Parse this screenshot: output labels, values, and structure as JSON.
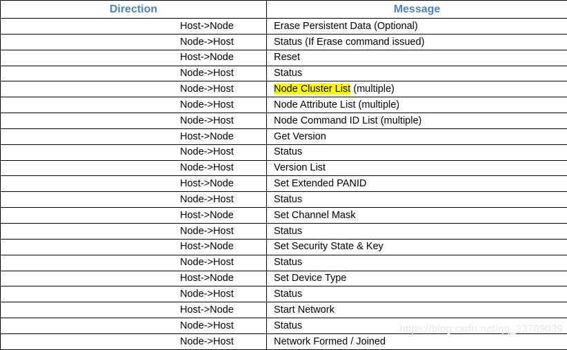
{
  "table": {
    "columns": [
      {
        "key": "direction",
        "label": "Direction"
      },
      {
        "key": "message",
        "label": "Message"
      }
    ],
    "header_color": "#4f81bd",
    "border_color": "#000000",
    "highlight_color": "#ffff00",
    "rows": [
      {
        "direction": "Host->Node",
        "message": "Erase Persistent Data (Optional)"
      },
      {
        "direction": "Node->Host",
        "message": "Status (If Erase command issued)"
      },
      {
        "direction": "Host->Node",
        "message": "Reset"
      },
      {
        "direction": "Node->Host",
        "message": "Status"
      },
      {
        "direction": "Node->Host",
        "message": "Node Cluster List (multiple)",
        "highlight_text": "Node Cluster List",
        "rest_text": " (multiple)",
        "highlighted": true
      },
      {
        "direction": "Node->Host",
        "message": "Node Attribute List (multiple)"
      },
      {
        "direction": "Node->Host",
        "message": "Node Command ID List (multiple)"
      },
      {
        "direction": "Host->Node",
        "message": "Get Version"
      },
      {
        "direction": "Node->Host",
        "message": "Status"
      },
      {
        "direction": "Node->Host",
        "message": "Version List"
      },
      {
        "direction": "Host->Node",
        "message": "Set Extended PANID"
      },
      {
        "direction": "Node->Host",
        "message": "Status"
      },
      {
        "direction": "Host->Node",
        "message": "Set Channel Mask"
      },
      {
        "direction": "Node->Host",
        "message": "Status"
      },
      {
        "direction": "Host->Node",
        "message": "Set Security State & Key"
      },
      {
        "direction": "Node->Host",
        "message": "Status"
      },
      {
        "direction": "Host->Node",
        "message": "Set Device Type"
      },
      {
        "direction": "Node->Host",
        "message": "Status"
      },
      {
        "direction": "Host->Node",
        "message": "Start Network"
      },
      {
        "direction": "Node->Host",
        "message": "Status"
      },
      {
        "direction": "Node->Host",
        "message": "Network Formed / Joined"
      }
    ]
  },
  "watermark": {
    "text": "https://blog.csdn.net/qq_33789039"
  }
}
